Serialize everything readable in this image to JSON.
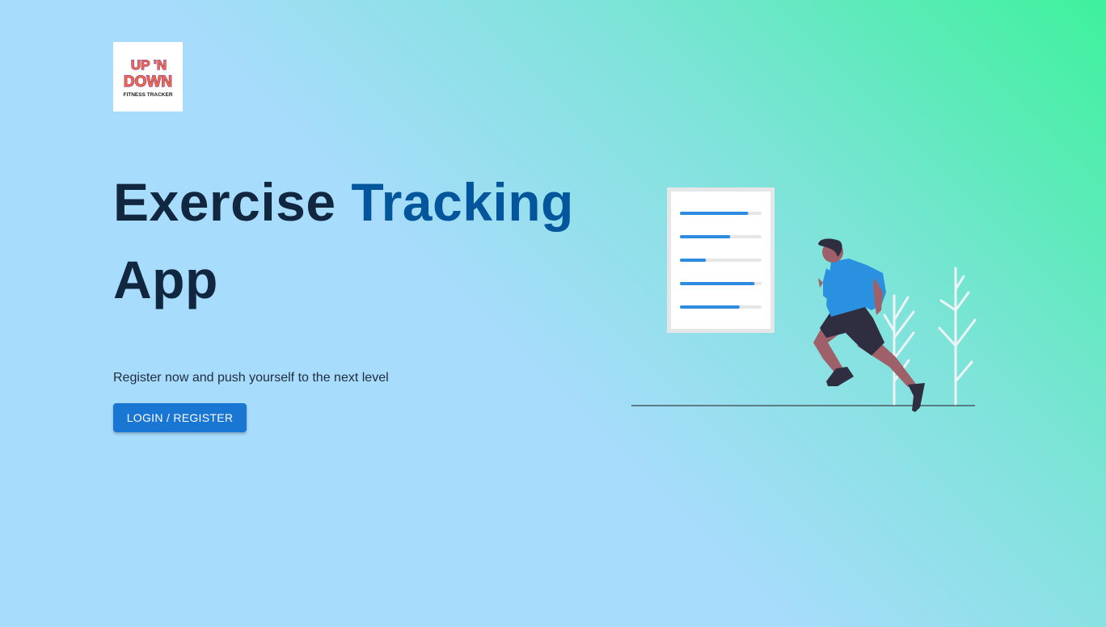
{
  "brand": {
    "logo_line1": "UP 'N",
    "logo_line2": "DOWN",
    "logo_tagline": "FITNESS TRACKER"
  },
  "hero": {
    "title_part1": "Exercise",
    "title_accent": "Tracking",
    "title_part2": "App",
    "subtitle": "Register now and push yourself to the next level",
    "cta_label": "LOGIN / REGISTER"
  },
  "illustration": {
    "progress_bars": [
      0.83,
      0.6,
      0.29,
      0.91,
      0.72
    ]
  },
  "colors": {
    "title": "#11263f",
    "accent": "#03569c",
    "button": "#1976d2",
    "progress_fill": "#2e8ce0",
    "progress_track": "#e6e6e6"
  }
}
